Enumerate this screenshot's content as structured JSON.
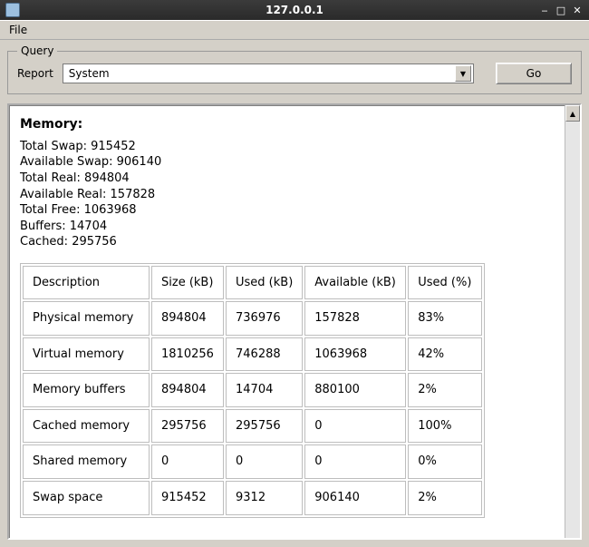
{
  "window": {
    "title": "127.0.0.1"
  },
  "menubar": {
    "file": "File"
  },
  "query": {
    "legend": "Query",
    "report_label": "Report",
    "report_value": "System",
    "go": "Go"
  },
  "memory": {
    "heading": "Memory:",
    "stats": {
      "total_swap_label": "Total Swap:",
      "total_swap": "915452",
      "avail_swap_label": "Available Swap:",
      "avail_swap": "906140",
      "total_real_label": "Total Real:",
      "total_real": "894804",
      "avail_real_label": "Available Real:",
      "avail_real": "157828",
      "total_free_label": "Total Free:",
      "total_free": "1063968",
      "buffers_label": "Buffers:",
      "buffers": "14704",
      "cached_label": "Cached:",
      "cached": "295756"
    },
    "table": {
      "headers": {
        "desc": "Description",
        "size": "Size (kB)",
        "used": "Used (kB)",
        "avail": "Available (kB)",
        "pct": "Used (%)"
      },
      "rows": [
        {
          "desc": "Physical memory",
          "size": "894804",
          "used": "736976",
          "avail": "157828",
          "pct": "83%"
        },
        {
          "desc": "Virtual memory",
          "size": "1810256",
          "used": "746288",
          "avail": "1063968",
          "pct": "42%"
        },
        {
          "desc": "Memory buffers",
          "size": "894804",
          "used": "14704",
          "avail": "880100",
          "pct": "2%"
        },
        {
          "desc": "Cached memory",
          "size": "295756",
          "used": "295756",
          "avail": "0",
          "pct": "100%"
        },
        {
          "desc": "Shared memory",
          "size": "0",
          "used": "0",
          "avail": "0",
          "pct": "0%"
        },
        {
          "desc": "Swap space",
          "size": "915452",
          "used": "9312",
          "avail": "906140",
          "pct": "2%"
        }
      ]
    }
  }
}
